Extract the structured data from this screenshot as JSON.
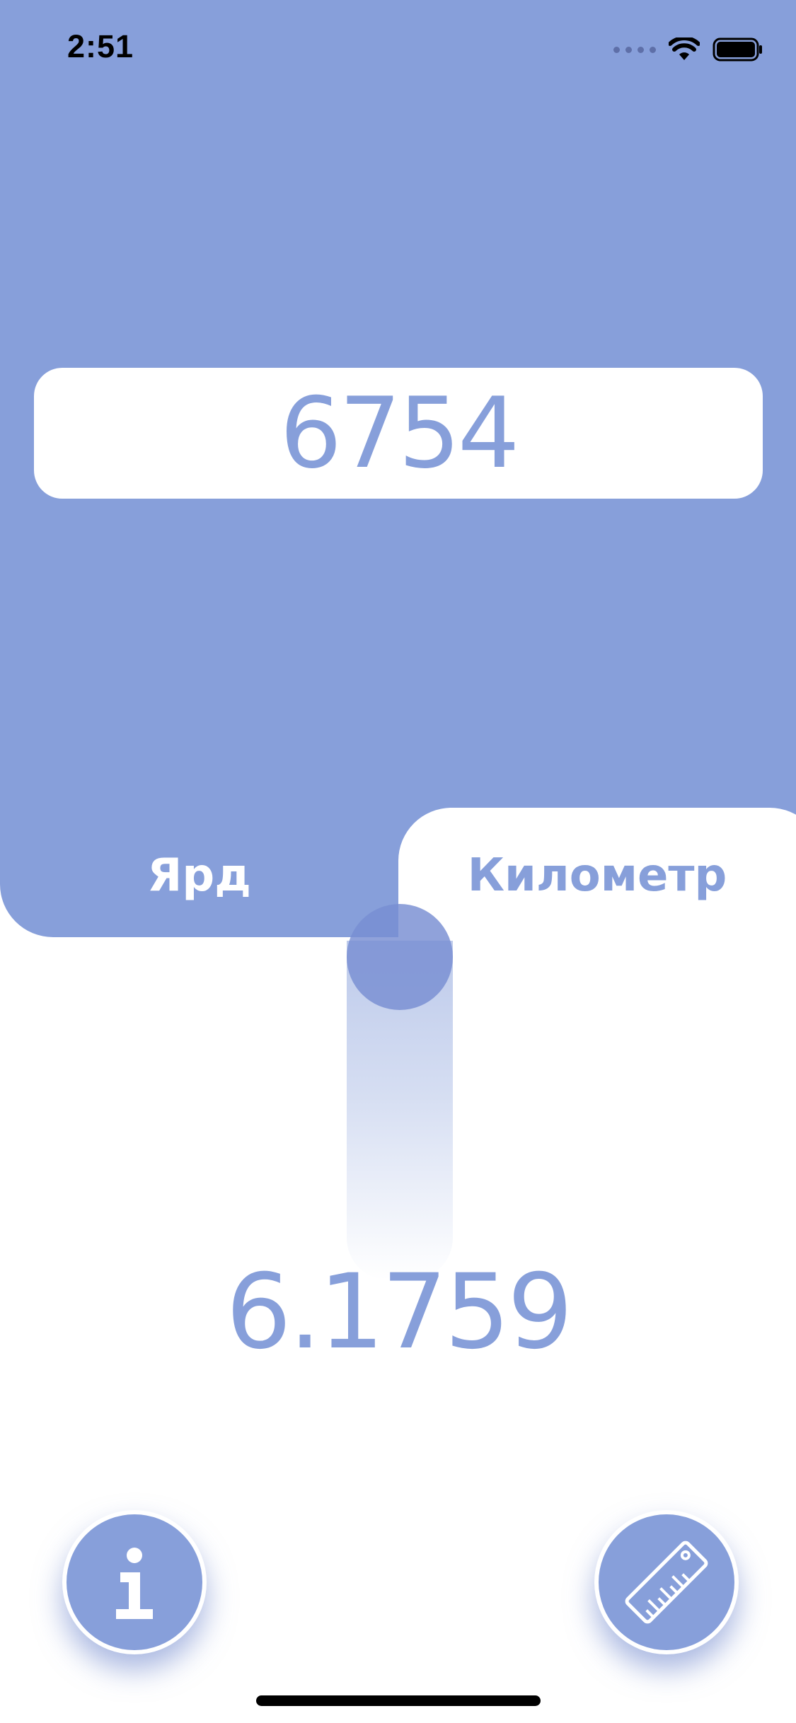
{
  "status_bar": {
    "time": "2:51"
  },
  "converter": {
    "input_value": "6754",
    "from_unit": "Ярд",
    "to_unit": "Километр",
    "result_value": "6.1759"
  },
  "colors": {
    "accent": "#879fda",
    "background": "#ffffff"
  },
  "icons": {
    "info": "info-icon",
    "ruler": "ruler-icon"
  }
}
